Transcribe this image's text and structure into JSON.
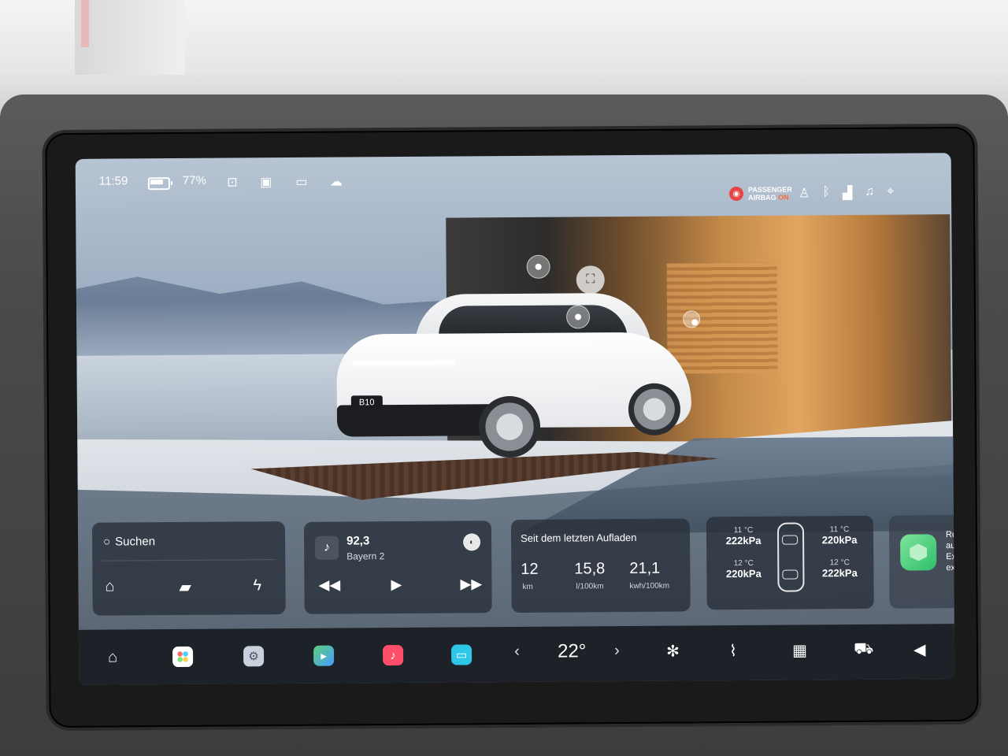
{
  "status_bar": {
    "time": "11:59",
    "battery_percent": "77%",
    "left_icons": [
      "battery-icon",
      "unlock-icon",
      "phone-key-icon",
      "camera-icon",
      "cloud-download-icon"
    ],
    "airbag_line1": "PASSENGER",
    "airbag_line2": "AIRBAG",
    "airbag_state": "ON",
    "right_icons": [
      "seatbelt-icon",
      "bluetooth-icon",
      "signal-4g-icon",
      "bell-icon",
      "location-icon"
    ]
  },
  "scene": {
    "car_badge": "B10"
  },
  "search_card": {
    "label": "Suchen",
    "quick_actions": [
      "home-icon",
      "briefcase-icon",
      "lightning-icon"
    ]
  },
  "music_card": {
    "frequency": "92,3",
    "station": "Bayern 2",
    "controls": [
      "rewind-icon",
      "play-icon",
      "fast-forward-icon"
    ]
  },
  "stats_card": {
    "title": "Seit dem letzten Aufladen",
    "distance_value": "12",
    "distance_unit": "km",
    "fuel_value": "15,8",
    "fuel_unit": "l/100km",
    "energy_value": "21,1",
    "energy_unit": "kwh/100km"
  },
  "tire_card": {
    "front_left_temp": "11 °C",
    "front_left_pressure": "222kPa",
    "rear_left_temp": "12 °C",
    "rear_left_pressure": "220kPa",
    "front_right_temp": "11 °C",
    "front_right_pressure": "220kPa",
    "rear_right_temp": "12 °C",
    "rear_right_pressure": "222kPa"
  },
  "app_card": {
    "peek_lines": [
      "Ro",
      "au",
      "Ex",
      "ex"
    ]
  },
  "dock": {
    "apps": [
      "home-icon",
      "apps-grid-icon",
      "settings-icon",
      "maps-icon",
      "music-icon",
      "tv-icon"
    ],
    "temperature": "22°",
    "controls": [
      "fan-icon",
      "seat-heat-icon",
      "rear-defrost-icon",
      "car-climate-icon",
      "volume-icon"
    ]
  },
  "colors": {
    "dock_bg": "#181c22",
    "card_bg": "#282e38",
    "airbag_on": "#ff6a3d",
    "accent_green": "#2fbf6a"
  }
}
